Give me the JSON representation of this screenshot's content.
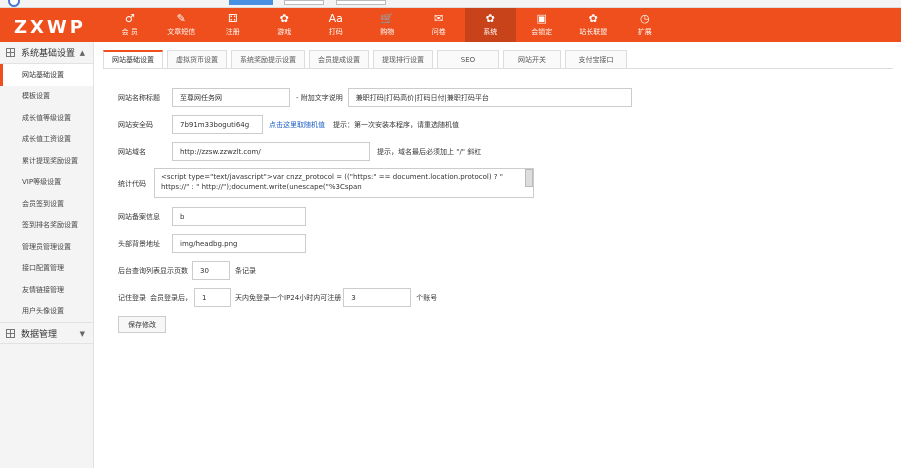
{
  "logo": "ZXWP",
  "topnav": [
    {
      "icon": "♂",
      "label": "会 员"
    },
    {
      "icon": "✎",
      "label": "文章短信"
    },
    {
      "icon": "⚃",
      "label": "注册"
    },
    {
      "icon": "✿",
      "label": "游戏"
    },
    {
      "icon": "Aa",
      "label": "打码"
    },
    {
      "icon": "🛒",
      "label": "购物"
    },
    {
      "icon": "✉",
      "label": "问卷"
    },
    {
      "icon": "✿",
      "label": "系统"
    },
    {
      "icon": "▣",
      "label": "会锁定"
    },
    {
      "icon": "✿",
      "label": "站长联盟"
    },
    {
      "icon": "◷",
      "label": "扩展"
    }
  ],
  "sidebar": {
    "group1": "系统基础设置",
    "items": [
      "网站基础设置",
      "模板设置",
      "成长值等级设置",
      "成长值工资设置",
      "累计提现奖励设置",
      "VIP等级设置",
      "会员签到设置",
      "签到排名奖励设置",
      "管理员管理设置",
      "接口配置管理",
      "友情链接管理",
      "用户头像设置"
    ],
    "group2": "数据管理"
  },
  "tabs": [
    "网站基础设置",
    "虚拟货币设置",
    "系统奖励提示设置",
    "会员提成设置",
    "提现排行设置",
    "SEO",
    "网站开关",
    "支付宝接口"
  ],
  "form": {
    "site_name_label": "网站名称标题",
    "site_name": "至尊网任务网",
    "extra_label": "- 附加文字说明",
    "extra_value": "兼职打码|打码高价|打码日付|兼职打码平台",
    "security_label": "网站安全码",
    "security_value": "7b91m33boguti64g",
    "security_link": "点击这里取随机值",
    "security_hint": "提示：第一次安装本程序，请重选随机值",
    "domain_label": "网站域名",
    "domain_value": "http://zzsw.zzwzlt.com/",
    "domain_hint": "提示，域名最后必须加上 \"/\" 斜杠",
    "stat_label": "统计代码",
    "stat_code": "<script type=\"text/javascript\">var cnzz_protocol = ((\"https:\" == document.location.protocol) ? \" https://\" : \" http://\");document.write(unescape(\"%3Cspan",
    "icp_label": "网站备案信息",
    "icp_value": "b",
    "header_bg_label": "头部背景地址",
    "header_bg_value": "img/headbg.png",
    "pagesize_label": "后台查询列表显示页数",
    "pagesize_value": "30",
    "pagesize_unit": "条记录",
    "remember_label": "记住登录",
    "remember_prefix": "会员登录后，",
    "remember_days": "1",
    "remember_mid": "天内免登录一个IP24小时内可注册",
    "remember_count": "3",
    "remember_unit": "个账号",
    "save_label": "保存修改"
  },
  "colors": {
    "brand": "#ee4f1c",
    "link": "#1a5dc6"
  }
}
